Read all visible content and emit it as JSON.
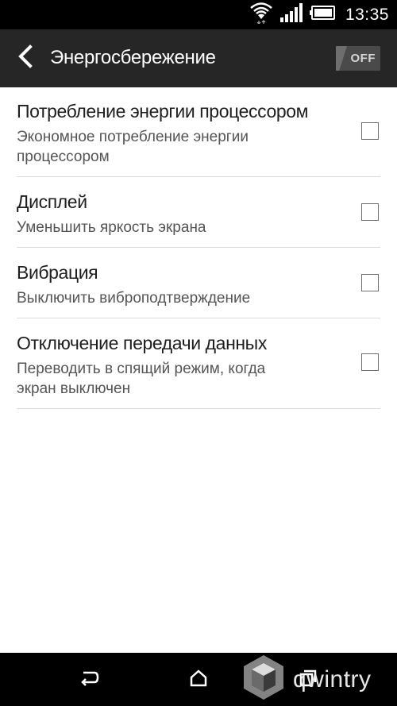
{
  "status_bar": {
    "time": "13:35",
    "icons": [
      "wifi-icon",
      "signal-icon",
      "battery-icon"
    ]
  },
  "action_bar": {
    "title": "Энергосбережение",
    "back_icon": "back-arrow-icon",
    "master_switch": {
      "label": "OFF",
      "state": "off"
    }
  },
  "preferences": [
    {
      "title": "Потребление энергии процессором",
      "summary": "Экономное потребление энергии процессором",
      "checked": false
    },
    {
      "title": "Дисплей",
      "summary": "Уменьшить яркость экрана",
      "checked": false
    },
    {
      "title": "Вибрация",
      "summary": "Выключить виброподтверждение",
      "checked": false
    },
    {
      "title": "Отключение передачи данных",
      "summary": "Переводить в спящий режим, когда экран выключен",
      "checked": false
    }
  ],
  "nav_bar": {
    "buttons": [
      "back-icon",
      "home-icon",
      "recent-apps-icon"
    ]
  },
  "watermark": {
    "text": "qwintry"
  },
  "colors": {
    "status_bar_bg": "#000000",
    "action_bar_bg": "#262626",
    "divider": "#dcdcdc",
    "title_text": "#1e1e1e",
    "summary_text": "#555555"
  }
}
